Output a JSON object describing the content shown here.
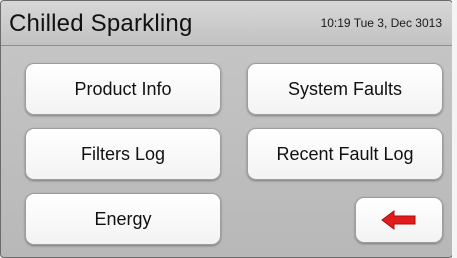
{
  "header": {
    "title": "Chilled Sparkling",
    "datetime": "10:19 Tue 3, Dec 3013"
  },
  "menu": {
    "product_info": "Product Info",
    "system_faults": "System Faults",
    "filters_log": "Filters Log",
    "recent_fault_log": "Recent Fault Log",
    "energy": "Energy"
  },
  "back": {
    "icon": "back-arrow-icon",
    "color": "#e21b1b"
  }
}
